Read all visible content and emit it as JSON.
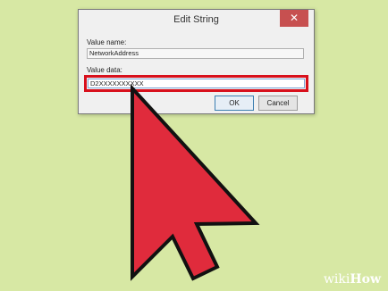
{
  "dialog": {
    "title": "Edit String",
    "close_glyph": "✕",
    "value_name_label": "Value name:",
    "value_name": "NetworkAddress",
    "value_data_label": "Value data:",
    "value_data": "D2XXXXXXXXXX",
    "ok_label": "OK",
    "cancel_label": "Cancel"
  },
  "overlay": {
    "arrow_color": "#e02b3c",
    "highlight_color": "#d8101c",
    "background_color": "#d7e8a4"
  },
  "watermark": {
    "part1": "wiki",
    "part2": "How"
  }
}
